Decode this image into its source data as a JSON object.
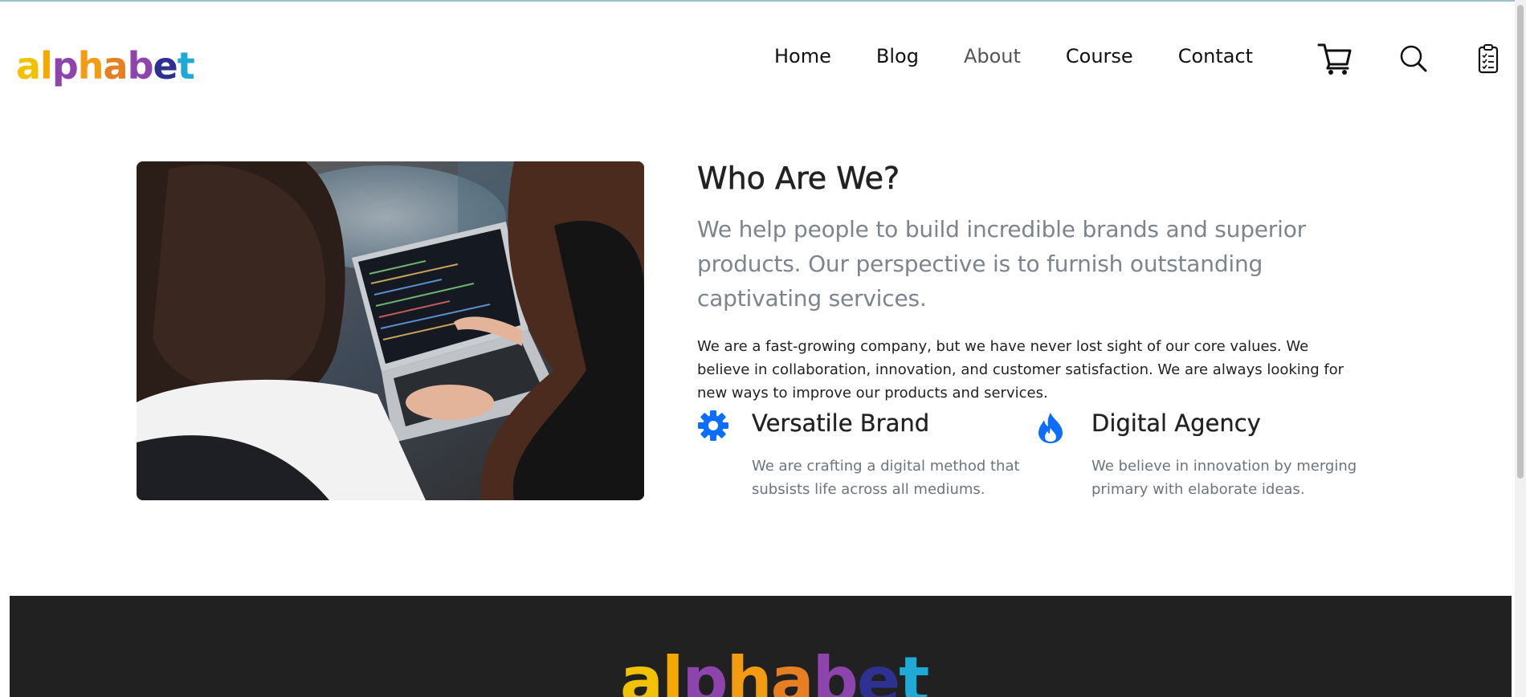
{
  "brand": {
    "letters": [
      {
        "ch": "a",
        "color": "#f2c200"
      },
      {
        "ch": "l",
        "color": "#f5a800"
      },
      {
        "ch": "p",
        "color": "#8e44ad"
      },
      {
        "ch": "h",
        "color": "#f39c12"
      },
      {
        "ch": "a",
        "color": "#e67e22"
      },
      {
        "ch": "b",
        "color": "#8e44ad"
      },
      {
        "ch": "e",
        "color": "#2e3192"
      },
      {
        "ch": "t",
        "color": "#1fa9d6"
      }
    ]
  },
  "nav": {
    "items": [
      {
        "label": "Home",
        "active": false
      },
      {
        "label": "Blog",
        "active": false
      },
      {
        "label": "About",
        "active": true
      },
      {
        "label": "Course",
        "active": false
      },
      {
        "label": "Contact",
        "active": false
      }
    ]
  },
  "header_icons": [
    "cart-icon",
    "search-icon",
    "clipboard-list-icon"
  ],
  "about": {
    "title": "Who Are We?",
    "lead": "We help people to build incredible brands and superior products. Our perspective is to furnish outstanding captivating services.",
    "body": "We are a fast-growing company, but we have never lost sight of our core values. We believe in collaboration, innovation, and customer satisfaction. We are always looking for new ways to improve our products and services.",
    "features": [
      {
        "icon": "gear-icon",
        "title": "Versatile Brand",
        "text": "We are crafting a digital method that subsists life across all mediums."
      },
      {
        "icon": "fire-icon",
        "title": "Digital Agency",
        "text": "We believe in innovation by merging primary with elaborate ideas."
      }
    ]
  },
  "colors": {
    "accent": "#0d6efd",
    "footer_bg": "#212121",
    "muted_text": "#6c757d"
  }
}
